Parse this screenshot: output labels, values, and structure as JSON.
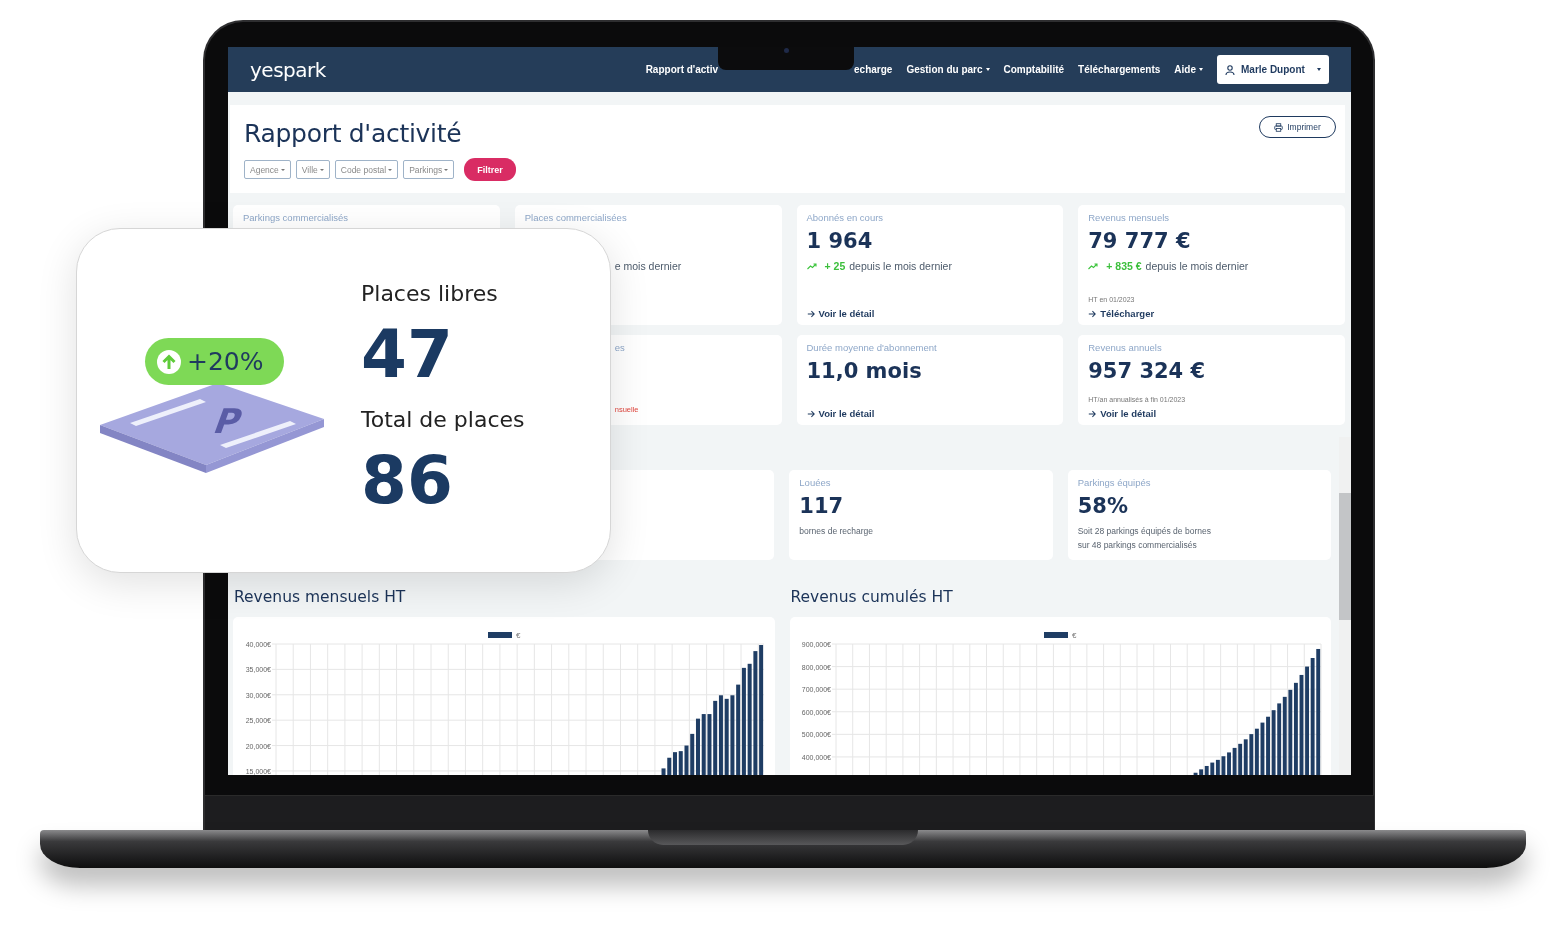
{
  "nav": {
    "brand": "yespark",
    "left_items": [
      {
        "label": "Rapport d'activ",
        "caret": false
      }
    ],
    "right_items": [
      {
        "label": "echarge",
        "caret": false
      },
      {
        "label": "Gestion du parc",
        "caret": true
      },
      {
        "label": "Comptabilité",
        "caret": false
      },
      {
        "label": "Téléchargements",
        "caret": false
      },
      {
        "label": "Aide",
        "caret": true
      }
    ],
    "user": "Marle Dupont"
  },
  "header": {
    "title": "Rapport d'activité",
    "filters": [
      "Agence",
      "Ville",
      "Code postal",
      "Parkings"
    ],
    "filter_button": "Filtrer",
    "print_button": "Imprimer"
  },
  "cards": [
    {
      "kind": "partial",
      "label": "Parkings commercialisés"
    },
    {
      "kind": "partial",
      "label": "Places commercialisées",
      "trend_tail": "e mois dernier"
    },
    {
      "kind": "stat",
      "label": "Abonnés en cours",
      "value": "1 964",
      "delta": "+ 25",
      "trend": "depuis le mois dernier",
      "link": "Voir le détail"
    },
    {
      "kind": "stat",
      "label": "Revenus mensuels",
      "value": "79 777 €",
      "delta": "+ 835 €",
      "trend": "depuis le mois dernier",
      "note": "HT en 01/2023",
      "link": "Télécharger"
    },
    {
      "kind": "partial",
      "label_tail": "es",
      "alert_tail": "nsuelle"
    },
    {
      "kind": "stat",
      "label": "Durée moyenne d'abonnement",
      "value": "11,0 mois",
      "link": "Voir le détail"
    },
    {
      "kind": "stat",
      "label": "Revenus annuels",
      "value": "957 324 €",
      "note": "HT/an annualisés à fin 01/2023",
      "link": "Voir le détail"
    }
  ],
  "charger_cards": [
    {
      "kind": "partial"
    },
    {
      "kind": "stat",
      "label": "Louées",
      "value": "117",
      "lines": [
        "bornes de recharge"
      ]
    },
    {
      "kind": "stat",
      "label": "Parkings équipés",
      "value": "58%",
      "lines": [
        "Soit 28 parkings équipés de bornes",
        "sur 48 parkings commercialisés"
      ]
    }
  ],
  "charts": [
    {
      "title": "Revenus mensuels HT",
      "chart_data": {
        "type": "bar",
        "grid": true,
        "ylim": [
          14200,
          40000
        ],
        "yticks": [
          {
            "value": 15000,
            "label": "15,000€"
          },
          {
            "value": 20000,
            "label": "20,000€"
          },
          {
            "value": 25000,
            "label": "25,000€"
          },
          {
            "value": 30000,
            "label": "30,000€"
          },
          {
            "value": 35000,
            "label": "35,000€"
          },
          {
            "value": 40000,
            "label": "40,000€"
          }
        ],
        "series": [
          {
            "name": "€",
            "color": "#1f3d64",
            "values": [
              null,
              null,
              null,
              null,
              null,
              null,
              null,
              null,
              null,
              null,
              null,
              null,
              null,
              null,
              null,
              null,
              null,
              null,
              null,
              null,
              null,
              null,
              null,
              null,
              null,
              null,
              null,
              null,
              null,
              null,
              null,
              null,
              null,
              null,
              null,
              null,
              null,
              null,
              null,
              null,
              null,
              null,
              null,
              null,
              null,
              null,
              null,
              null,
              null,
              null,
              null,
              null,
              null,
              null,
              null,
              null,
              null,
              null,
              null,
              null,
              null,
              null,
              null,
              null,
              null,
              null,
              null,
              15500,
              17600,
              18700,
              18900,
              20000,
              22300,
              25300,
              26200,
              26200,
              28800,
              29900,
              29200,
              29900,
              32000,
              35300,
              36100,
              38600,
              39800
            ]
          }
        ]
      }
    },
    {
      "title": "Revenus cumulés HT",
      "chart_data": {
        "type": "bar",
        "grid": true,
        "ylim": [
          320000,
          900000
        ],
        "yticks": [
          {
            "value": 400000,
            "label": "400,000€"
          },
          {
            "value": 500000,
            "label": "500,000€"
          },
          {
            "value": 600000,
            "label": "600,000€"
          },
          {
            "value": 700000,
            "label": "700,000€"
          },
          {
            "value": 800000,
            "label": "800,000€"
          },
          {
            "value": 900000,
            "label": "900,000€"
          }
        ],
        "series": [
          {
            "name": "€",
            "color": "#1f3d64",
            "values": [
              null,
              null,
              null,
              null,
              null,
              null,
              null,
              null,
              null,
              null,
              null,
              null,
              null,
              null,
              null,
              null,
              null,
              null,
              null,
              null,
              null,
              null,
              null,
              null,
              null,
              null,
              null,
              null,
              null,
              null,
              null,
              null,
              null,
              null,
              null,
              null,
              null,
              null,
              null,
              null,
              null,
              null,
              null,
              null,
              null,
              null,
              null,
              null,
              null,
              null,
              null,
              null,
              null,
              null,
              null,
              null,
              null,
              null,
              null,
              null,
              null,
              null,
              null,
              null,
              330000,
              345000,
              360000,
              375000,
              387000,
              403000,
              420000,
              440000,
              458000,
              478000,
              501000,
              525000,
              552000,
              578000,
              607000,
              637000,
              666000,
              697000,
              728000,
              763000,
              800000,
              838000,
              878000
            ]
          }
        ]
      }
    }
  ],
  "overlay": {
    "badge": "+20%",
    "tile_letter": "P",
    "stats": [
      {
        "label": "Places libres",
        "value": "47"
      },
      {
        "label": "Total de places",
        "value": "86"
      }
    ]
  }
}
